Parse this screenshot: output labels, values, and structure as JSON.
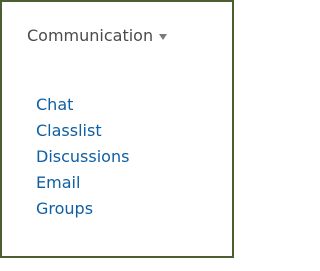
{
  "menu": {
    "title": "Communication",
    "caret_icon": "chevron-down-icon",
    "items": [
      {
        "label": "Chat"
      },
      {
        "label": "Classlist"
      },
      {
        "label": "Discussions"
      },
      {
        "label": "Email"
      },
      {
        "label": "Groups"
      }
    ]
  },
  "colors": {
    "border": "#4b5f31",
    "link": "#0f5fa3",
    "header_text": "#4b4b4b",
    "caret": "#7a7a7a"
  }
}
